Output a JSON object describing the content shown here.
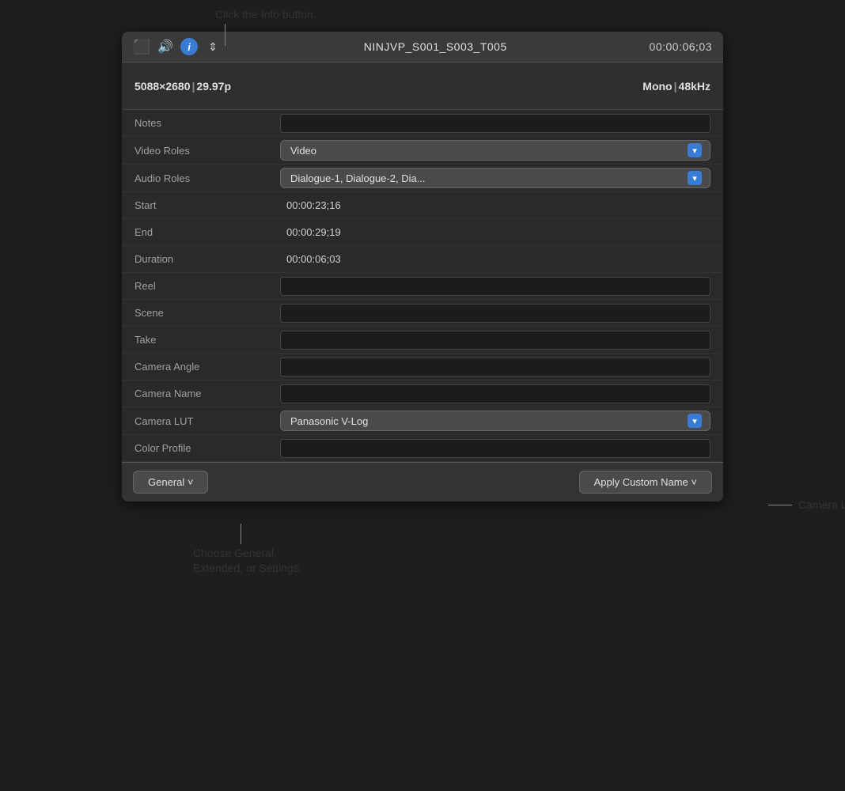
{
  "callout_top": "Click the Info button.",
  "toolbar": {
    "title": "NINJVP_S001_S003_T005",
    "timecode": "00:00:06;03",
    "icons": {
      "film": "🎞",
      "speaker": "🔊",
      "info": "i",
      "transform": "⇕"
    }
  },
  "media_info": {
    "resolution": "5088",
    "resolution_x": "×",
    "resolution_y": "2680",
    "framerate": "29.97p",
    "audio_mode": "Mono",
    "sample_rate": "48kHz"
  },
  "properties": [
    {
      "label": "Notes",
      "type": "input",
      "value": ""
    },
    {
      "label": "Video Roles",
      "type": "dropdown",
      "value": "Video"
    },
    {
      "label": "Audio Roles",
      "type": "dropdown",
      "value": "Dialogue-1, Dialogue-2, Dia..."
    },
    {
      "label": "Start",
      "type": "text",
      "value": "00:00:23;16"
    },
    {
      "label": "End",
      "type": "text",
      "value": "00:00:29;19"
    },
    {
      "label": "Duration",
      "type": "text",
      "value": "00:00:06;03"
    },
    {
      "label": "Reel",
      "type": "input",
      "value": ""
    },
    {
      "label": "Scene",
      "type": "input",
      "value": ""
    },
    {
      "label": "Take",
      "type": "input",
      "value": ""
    },
    {
      "label": "Camera Angle",
      "type": "input",
      "value": ""
    },
    {
      "label": "Camera Name",
      "type": "input",
      "value": ""
    },
    {
      "label": "Camera LUT",
      "type": "dropdown",
      "value": "Panasonic V-Log"
    },
    {
      "label": "Color Profile",
      "type": "input",
      "value": ""
    }
  ],
  "footer": {
    "general_btn": "General ˅",
    "apply_btn": "Apply Custom Name ˅"
  },
  "callout_right": "Camera LUT setting",
  "callout_bottom": "Choose General,\nExtended, or Settings."
}
